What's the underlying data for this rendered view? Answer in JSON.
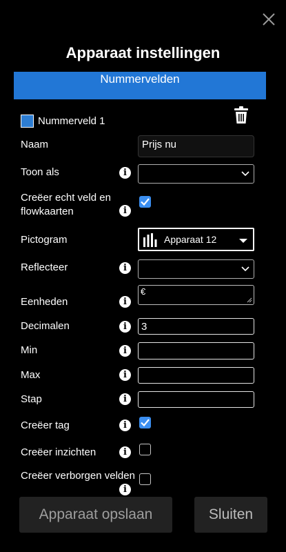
{
  "dialog": {
    "title": "Apparaat instellingen"
  },
  "section": {
    "label": "Nummervelden"
  },
  "field": {
    "name": "Nummerveld 1",
    "swatch_color": "#2d7dd2"
  },
  "form": {
    "naam": {
      "label": "Naam",
      "value": "Prijs nu"
    },
    "toon_als": {
      "label": "Toon als",
      "value": ""
    },
    "creeer_echt": {
      "label_line1": "Creëer echt veld en",
      "label_line2": "flowkaarten",
      "checked": true
    },
    "pictogram": {
      "label": "Pictogram",
      "value": "Apparaat 12",
      "icon": "bar-chart-icon"
    },
    "reflecteer": {
      "label": "Reflecteer",
      "value": ""
    },
    "eenheden": {
      "label": "Eenheden",
      "value": "€"
    },
    "decimalen": {
      "label": "Decimalen",
      "value": "3"
    },
    "min": {
      "label": "Min",
      "value": ""
    },
    "max": {
      "label": "Max",
      "value": ""
    },
    "stap": {
      "label": "Stap",
      "value": ""
    },
    "creeer_tag": {
      "label": "Creëer tag",
      "checked": true
    },
    "creeer_inzichten": {
      "label": "Creëer inzichten",
      "checked": false
    },
    "creeer_verborgen": {
      "label": "Creëer verborgen velden",
      "checked": false
    }
  },
  "info_glyph": "i",
  "buttons": {
    "save": "Apparaat opslaan",
    "close": "Sluiten"
  },
  "colors": {
    "accent": "#2277d6",
    "checkbox": "#3b8ef0",
    "background": "#000000"
  }
}
